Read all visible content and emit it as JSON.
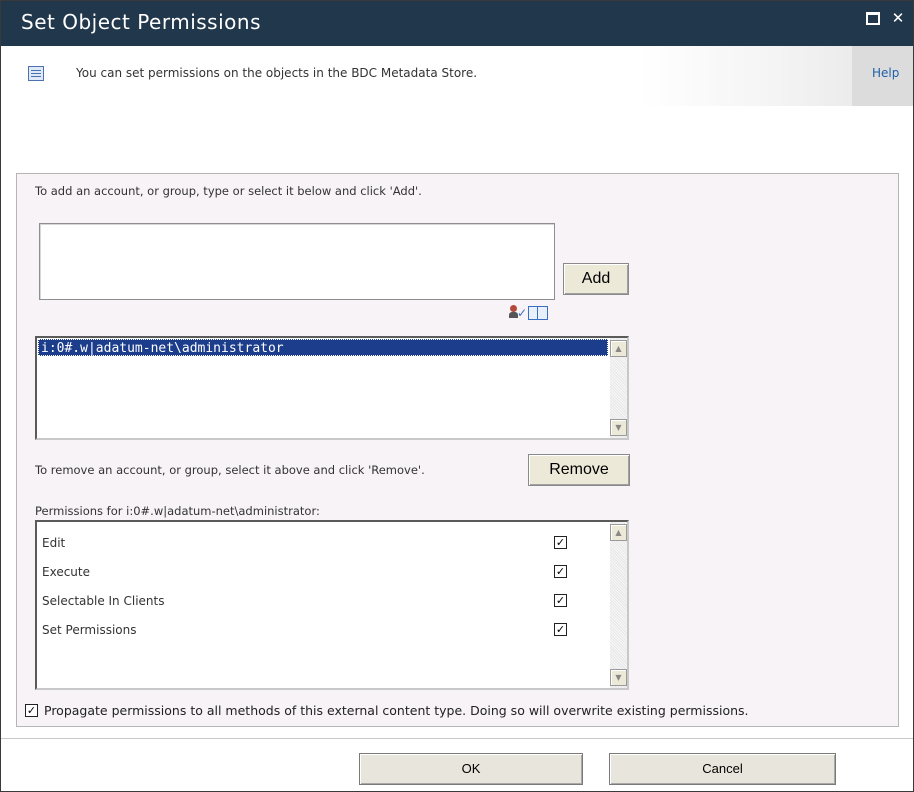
{
  "window": {
    "title": "Set Object Permissions"
  },
  "infobar": {
    "message": "You can set permissions on the objects in the BDC Metadata Store.",
    "help_label": "Help"
  },
  "add_section": {
    "instruction": "To add an account, or group, type or select it below and click 'Add'.",
    "input_value": "",
    "add_label": "Add"
  },
  "accounts": {
    "items": [
      "i:0#.w|adatum-net\\administrator"
    ],
    "selected": "i:0#.w|adatum-net\\administrator"
  },
  "remove_section": {
    "instruction": "To remove an account, or group, select it above and click 'Remove'.",
    "remove_label": "Remove"
  },
  "permissions": {
    "header": "Permissions for i:0#.w|adatum-net\\administrator:",
    "items": [
      {
        "label": "Edit",
        "checked": true
      },
      {
        "label": "Execute",
        "checked": true
      },
      {
        "label": "Selectable In Clients",
        "checked": true
      },
      {
        "label": "Set Permissions",
        "checked": true
      }
    ]
  },
  "propagate": {
    "label": "Propagate permissions to all methods of this external content type. Doing so will overwrite existing permissions.",
    "checked": true
  },
  "footer": {
    "ok_label": "OK",
    "cancel_label": "Cancel"
  },
  "colors": {
    "titlebar": "#21374c",
    "selection": "#1c3d8c",
    "panel": "#f7f3f7"
  }
}
